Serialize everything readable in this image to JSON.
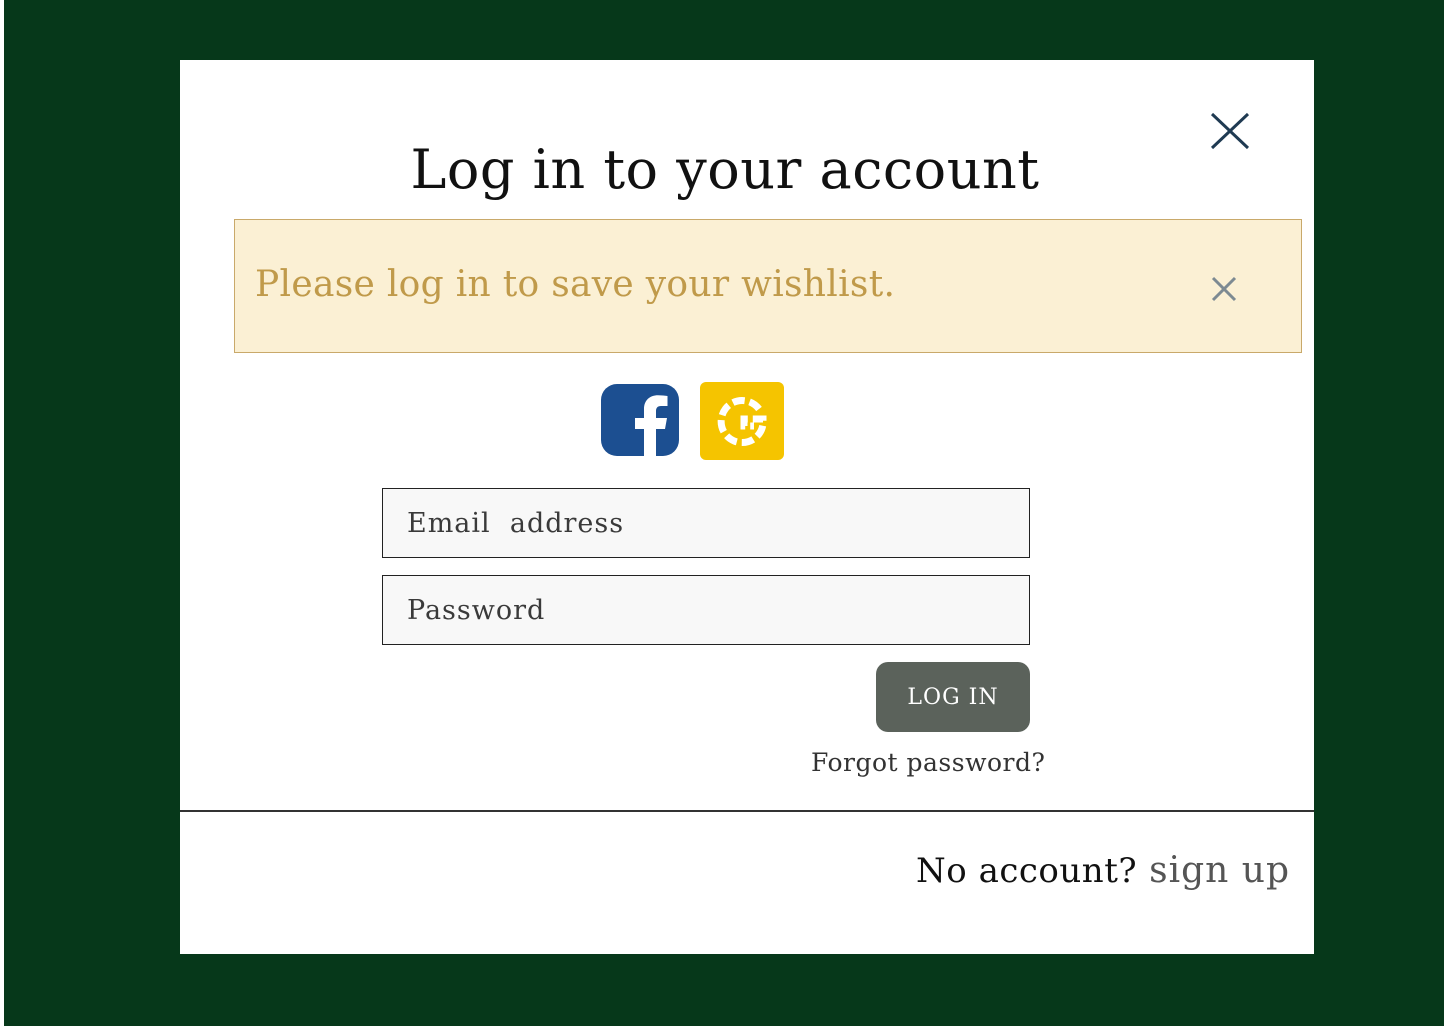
{
  "modal": {
    "title": "Log in to your account",
    "close_icon": "close-icon"
  },
  "alert": {
    "message": "Please log in to save your wishlist.",
    "close_icon": "close-icon",
    "background": "#fbf0d4",
    "text_color": "#c09a4a"
  },
  "social": {
    "facebook_icon": "facebook-icon",
    "google_icon": "google-icon",
    "facebook_color": "#1c4f91",
    "google_color": "#f5c400"
  },
  "form": {
    "email_placeholder": "Email  address",
    "password_placeholder": "Password",
    "login_label": "LOG IN",
    "forgot_label": "Forgot password?"
  },
  "footer": {
    "no_account_label": "No account?",
    "signup_label": "sign up"
  },
  "colors": {
    "backdrop": "#06381a",
    "button": "#5b625b"
  }
}
